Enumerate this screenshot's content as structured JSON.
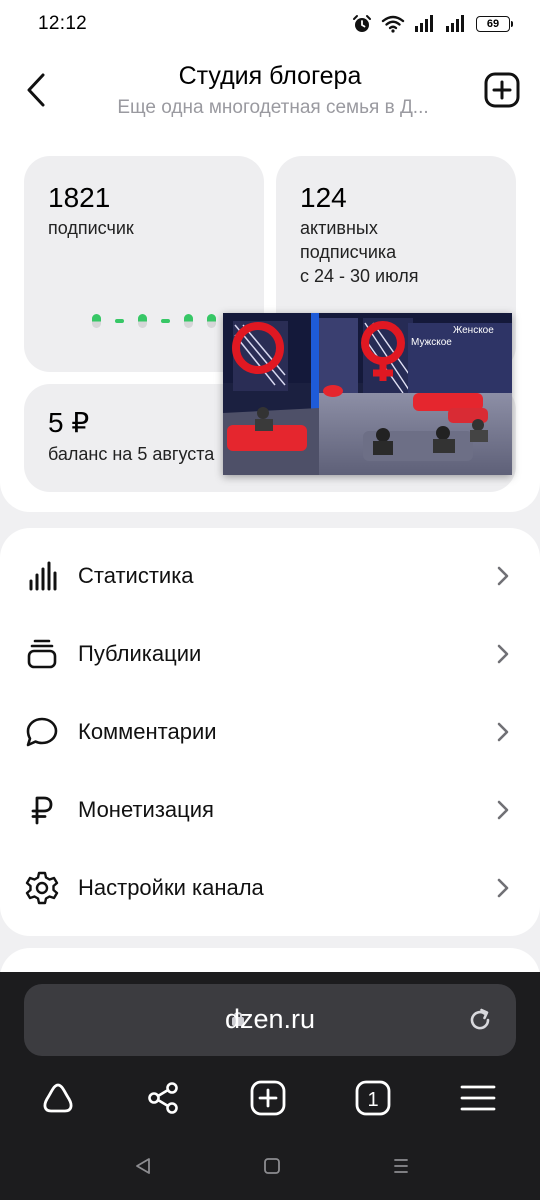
{
  "status_bar": {
    "time": "12:12",
    "battery": "69",
    "icons": [
      "alarm-icon",
      "wifi-icon",
      "signal-icon",
      "signal-icon",
      "battery-icon"
    ]
  },
  "header": {
    "title": "Студия блогера",
    "subtitle": "Еще одна многодетная семья в Д...",
    "icons": [
      "back-arrow-icon",
      "add-square-icon"
    ]
  },
  "stats": {
    "subscribers": {
      "number": "1821",
      "label": "подписчик"
    },
    "active": {
      "number": "124",
      "label_lines": [
        "активных",
        "подписчика",
        "с 24 - 30 июля"
      ]
    },
    "balance": {
      "number": "5 ₽",
      "label": "баланс на 5 августа"
    },
    "accent_color": "#37c766"
  },
  "menu": [
    {
      "label": "Статистика",
      "icon": "bar-chart-icon"
    },
    {
      "label": "Публикации",
      "icon": "publications-stack-icon"
    },
    {
      "label": "Комментарии",
      "icon": "comment-bubble-icon"
    },
    {
      "label": "Монетизация",
      "icon": "ruble-icon"
    },
    {
      "label": "Настройки канала",
      "icon": "settings-gear-icon"
    }
  ],
  "video_overlay": {
    "description_icons": [
      "tv-studio-thumbnail"
    ]
  },
  "browser": {
    "url": "dzen.ru",
    "tab_count": "1",
    "icons": [
      "lock-icon",
      "reload-icon",
      "dzen-home-icon",
      "share-icon",
      "new-tab-icon",
      "tabs-icon",
      "menu-icon"
    ]
  },
  "system_nav": {
    "icons": [
      "nav-back-icon",
      "nav-home-icon",
      "nav-recents-icon"
    ]
  }
}
